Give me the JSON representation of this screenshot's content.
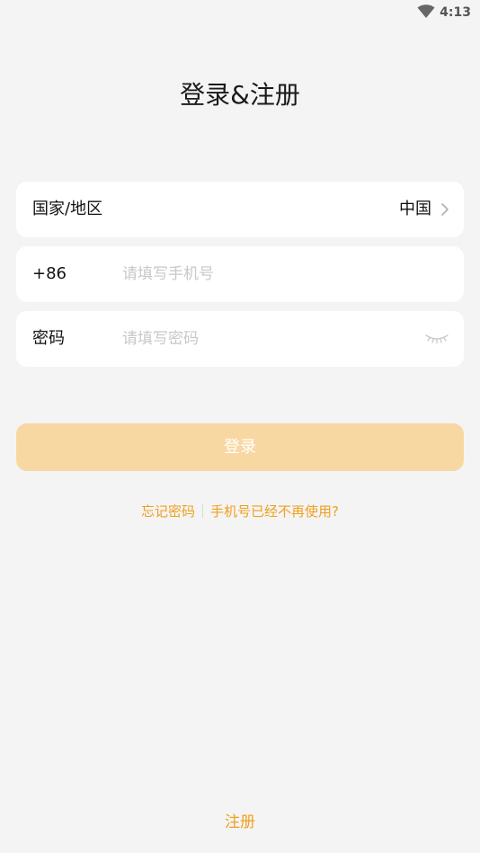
{
  "status_bar": {
    "time": "4:13",
    "wifi_icon": "wifi-icon"
  },
  "page": {
    "title": "登录&注册"
  },
  "region_row": {
    "label": "国家/地区",
    "value": "中国",
    "icon": "chevron-right-icon"
  },
  "phone_row": {
    "prefix": "+86",
    "value": "",
    "placeholder": "请填写手机号"
  },
  "password_row": {
    "label": "密码",
    "value": "",
    "placeholder": "请填写密码",
    "icon": "eye-closed-icon"
  },
  "login_button": {
    "label": "登录",
    "color": "#f8d8a2"
  },
  "links": {
    "forgot_password": "忘记密码",
    "phone_unavailable": "手机号已经不再使用?",
    "color": "#f0a01e"
  },
  "footer": {
    "register": "注册"
  }
}
